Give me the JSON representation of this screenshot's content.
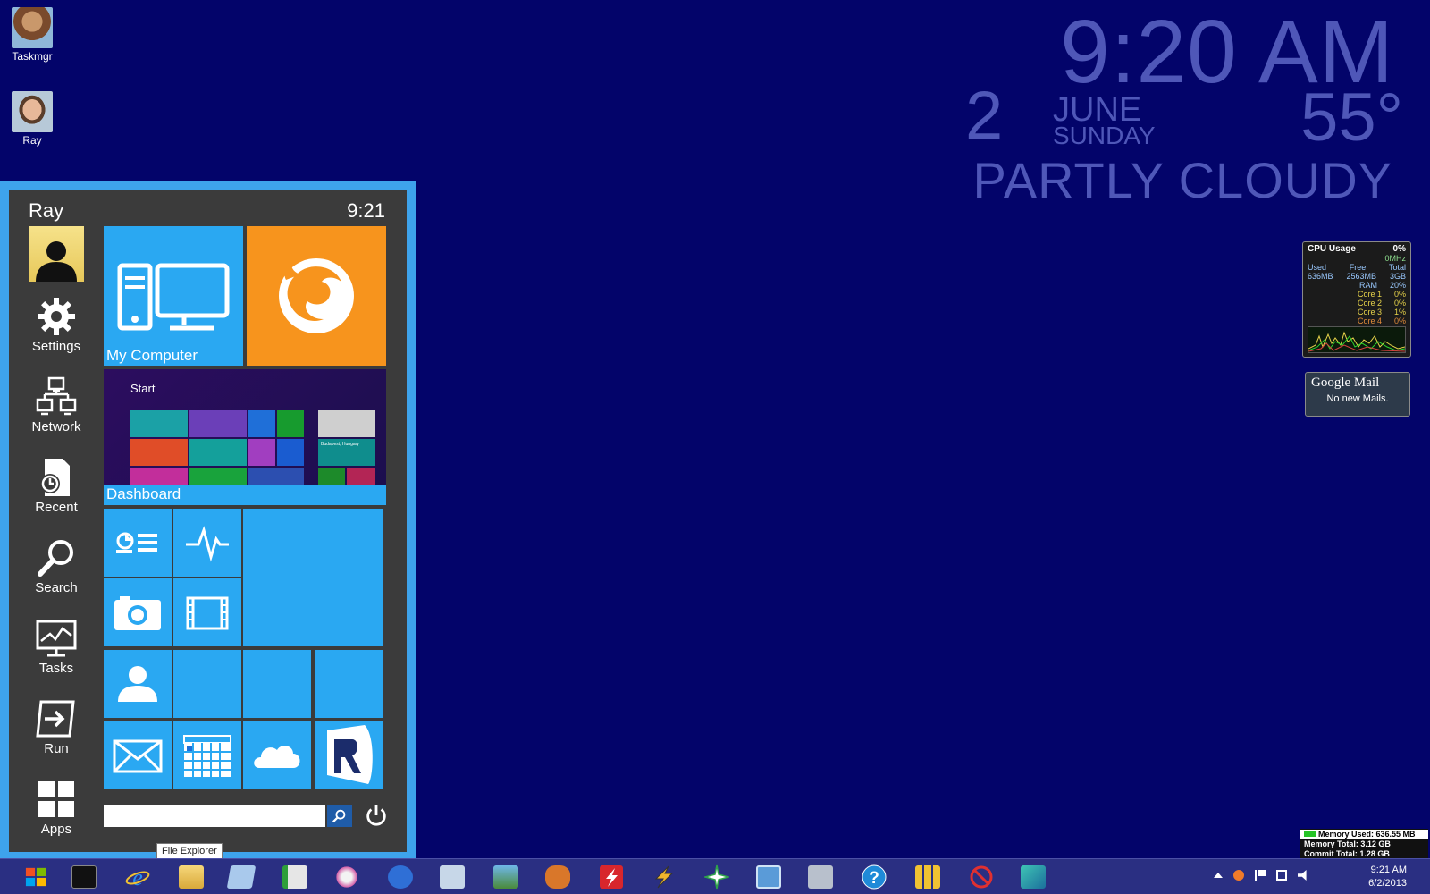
{
  "desktop": {
    "icons": [
      {
        "label": "Taskmgr"
      },
      {
        "label": "Ray"
      }
    ]
  },
  "clock_widget": {
    "time": "9:20 AM",
    "day": "2",
    "month": "JUNE",
    "weekday": "SUNDAY",
    "temperature": "55°",
    "condition": "PARTLY CLOUDY"
  },
  "cpu_gadget": {
    "title": "CPU Usage",
    "usage": "0%",
    "mhz": "0MHz",
    "used_label": "Used",
    "free_label": "Free",
    "total_label": "Total",
    "used": "636MB",
    "free": "2563MB",
    "total": "3GB",
    "rows": [
      {
        "label": "RAM",
        "value": "20%"
      },
      {
        "label": "Core 1",
        "value": "0%"
      },
      {
        "label": "Core 2",
        "value": "0%"
      },
      {
        "label": "Core 3",
        "value": "1%"
      },
      {
        "label": "Core 4",
        "value": "0%"
      }
    ]
  },
  "gmail_gadget": {
    "title": "Google Mail",
    "message": "No new Mails."
  },
  "start_menu": {
    "user": "Ray",
    "time": "9:21",
    "side_items": [
      {
        "label": "Settings",
        "icon": "gear-icon"
      },
      {
        "label": "Network",
        "icon": "network-icon"
      },
      {
        "label": "Recent",
        "icon": "recent-icon"
      },
      {
        "label": "Search",
        "icon": "search-icon"
      },
      {
        "label": "Tasks",
        "icon": "tasks-icon"
      },
      {
        "label": "Run",
        "icon": "run-icon"
      },
      {
        "label": "Apps",
        "icon": "apps-icon"
      }
    ],
    "tiles": {
      "my_computer": "My Computer",
      "dashboard": "Dashboard",
      "dashboard_preview_title": "Start",
      "dashboard_preview_caption": "Budapest, Hungary"
    },
    "search_placeholder": ""
  },
  "tooltip": "File Explorer",
  "memory_overlay": {
    "used": "Memory Used: 636.55 MB",
    "total": "Memory Total: 3.12 GB",
    "commit": "Commit Total: 1.28 GB"
  },
  "taskbar": {
    "clock_time": "9:21 AM",
    "clock_date": "6/2/2013",
    "colors": {
      "background": "#2a2f82",
      "desktop": "#03046a",
      "tile": "#2aa8f2",
      "firefox_tile": "#f7941d"
    }
  }
}
